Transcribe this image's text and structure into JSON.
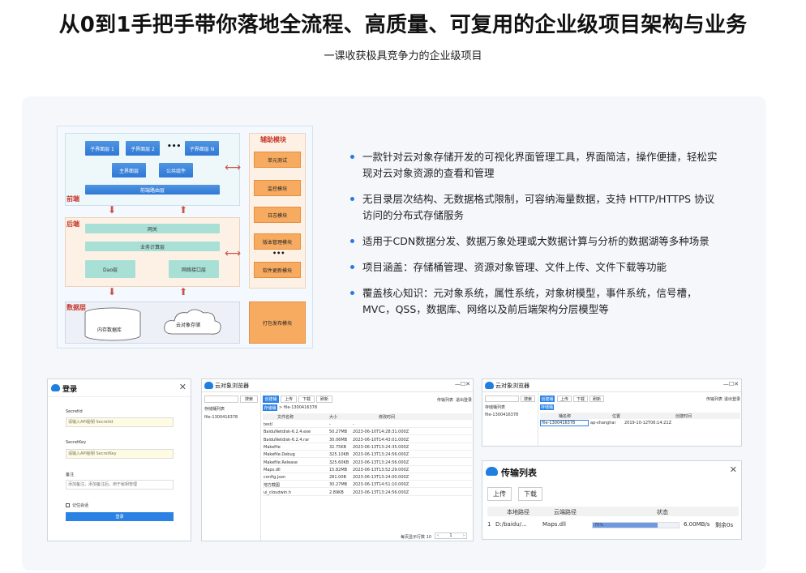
{
  "header": {
    "title": "从0到1手把手带你落地全流程、高质量、可复用的企业级项目架构与业务",
    "subtitle": "一课收获极具竞争力的企业级项目"
  },
  "diagram": {
    "frontend_label": "前端",
    "backend_label": "后端",
    "data_label": "数据层",
    "aux_label": "辅助模块",
    "sub_ui": [
      "子界面层 1",
      "子界面层 2",
      "子界面层 N"
    ],
    "ellipsis": "•••",
    "main_ui": "主界面层",
    "common": "公共组件",
    "router": "前端路由层",
    "gateway": "网关",
    "biz": "业务计算层",
    "dao": "Dao层",
    "net": "网络接口层",
    "memdb": "内存数据库",
    "cloud": "云对象存储",
    "aux_items": [
      "单元测试",
      "监控模块",
      "日志模块",
      "版本管理模块",
      "软件更新模块"
    ],
    "release": "打包发布模块",
    "colors": {
      "blue": "#2f78d6",
      "teal": "#a9e0d6",
      "orange": "#f7ab61",
      "red": "#c73a2c"
    }
  },
  "bullets": [
    "一款针对云对象存储开发的可视化界面管理工具，界面简洁，操作便捷，轻松实现对云对象资源的查看和管理",
    "无目录层次结构、无数据格式限制，可容纳海量数据，支持 HTTP/HTTPS 协议访问的分布式存储服务",
    "适用于CDN数据分发、数据万象处理或大数据计算与分析的数据湖等多种场景",
    "项目涵盖：存储桶管理、资源对象管理、文件上传、文件下载等功能",
    "覆盖核心知识：元对象系统，属性系统，对象树模型，事件系统，信号槽，MVC，QSS，数据库、网络以及前后端架构分层模型等"
  ],
  "login": {
    "title": "登录",
    "secret_id_label": "SecretId",
    "secret_id_placeholder": "请输入API秘钥 SecretId",
    "secret_key_label": "SecretKey",
    "secret_key_placeholder": "请输入API秘钥 SecretKey",
    "note_label": "备注",
    "note_placeholder": "添加备注，添加备注后，用于秘钥管理",
    "remember": "记住会话",
    "login_btn": "登录"
  },
  "browser": {
    "title": "云对象浏览器",
    "search": "搜索",
    "bucket_list": "存储桶列表",
    "bucket_item": "file-1300416378",
    "toolbar": [
      "创建桶",
      "上传",
      "下载",
      "刷新"
    ],
    "right_tools": [
      "传输列表",
      "退出登录"
    ],
    "path_btn": "存储桶",
    "path": "> file-1300416378",
    "columns": [
      "文件名称",
      "大小",
      "修改时间"
    ],
    "rows": [
      [
        "test/",
        "-",
        "-"
      ],
      [
        "BaiduNetdisk-6.2.4.exe",
        "50.27MB",
        "2023-06-10T14:28:31.000Z"
      ],
      [
        "BaiduNetdisk-6.2.4.rar",
        "30.06MB",
        "2023-06-10T14:43:01.000Z"
      ],
      [
        "Makefile",
        "32.75KB",
        "2023-06-13T13:24:35.000Z"
      ],
      [
        "Makefile.Debug",
        "325.10KB",
        "2023-06-13T13:24:56.000Z"
      ],
      [
        "Makefile.Release",
        "325.60KB",
        "2023-06-13T13:24:56.000Z"
      ],
      [
        "Maps.dll",
        "15.82MB",
        "2023-06-13T13:52:29.000Z"
      ],
      [
        "config.json",
        "281.00B",
        "2023-06-13T13:24:00.000Z"
      ],
      [
        "地方截图",
        "30.27MB",
        "2023-06-13T14:51:10.000Z"
      ],
      [
        "ui_cloudwin.h",
        "2.89KB",
        "2023-06-13T13:24:56.000Z"
      ]
    ],
    "pager": "每页显示行数 10",
    "page": "1"
  },
  "browser2": {
    "title": "云对象浏览器",
    "search": "搜索",
    "bucket_list": "存储桶列表",
    "bucket_item": "file-1300416378",
    "toolbar": [
      "创建桶",
      "上传",
      "下载",
      "刷新"
    ],
    "right_tools": [
      "传输列表",
      "退出登录"
    ],
    "path_btn": "存储桶",
    "columns": [
      "桶名称",
      "位置",
      "创建时间"
    ],
    "row": [
      "file-1300416378",
      "ap-shanghai",
      "2019-10-12T06:14:21Z"
    ]
  },
  "transfer": {
    "title": "传输列表",
    "tabs": [
      "上传",
      "下载"
    ],
    "columns": [
      "本地路径",
      "云端路径",
      "状态"
    ],
    "row_index": "1",
    "local": "D:/baidu/...",
    "remote": "Maps.dll",
    "progress": 0.75,
    "progress_text": "75%",
    "speed": "6.00MB/s",
    "remaining": "剩余0s"
  }
}
